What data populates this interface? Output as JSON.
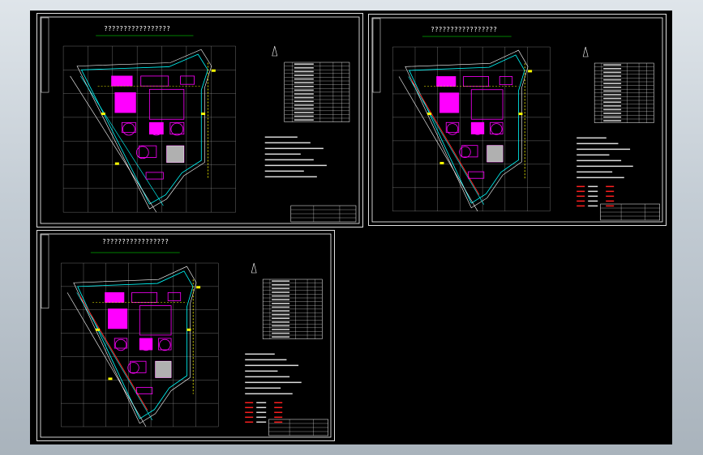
{
  "viewport": {
    "background": "#000000",
    "frame": "#c8d0d8"
  },
  "colors": {
    "border": "#ffffff",
    "magenta": "#ff00ff",
    "cyan": "#00ffff",
    "yellow": "#ffff00",
    "red": "#ff2020",
    "green": "#00ff00",
    "gray": "#9a9a9a"
  },
  "sheets": [
    {
      "id": "sheet-1",
      "title": "?????????????????"
    },
    {
      "id": "sheet-2",
      "title": "?????????????????"
    },
    {
      "id": "sheet-3",
      "title": "?????????????????"
    }
  ]
}
